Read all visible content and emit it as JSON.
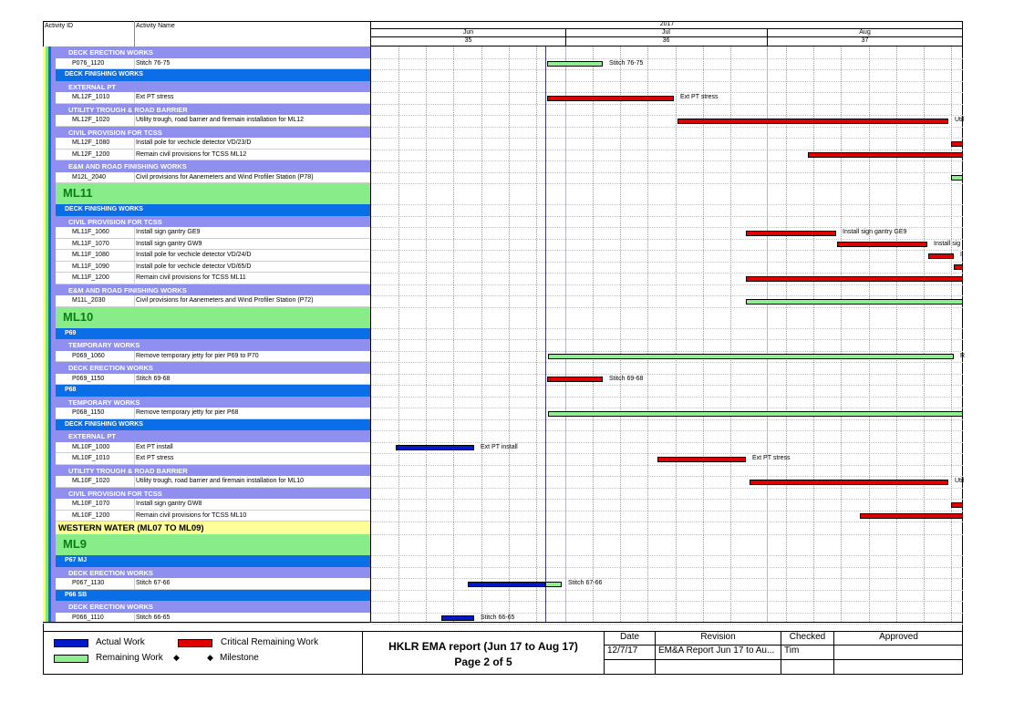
{
  "header": {
    "col_activity_id": "Activity ID",
    "col_activity_name": "Activity Name",
    "year": "2017",
    "months": [
      "Jun",
      "Jul",
      "Aug"
    ],
    "weeks": [
      "35",
      "36",
      "37"
    ]
  },
  "rows": [
    {
      "kind": "wbs3",
      "label": "DECK ERECTION WORKS"
    },
    {
      "kind": "act",
      "id": "P076_1120",
      "name": "Stitch 76-75",
      "bar": "green",
      "bar_label": "Stitch 76-75"
    },
    {
      "kind": "wbs2",
      "label": "DECK FINISHING WORKS"
    },
    {
      "kind": "wbs3",
      "label": "EXTERNAL PT"
    },
    {
      "kind": "act",
      "id": "ML12F_1010",
      "name": "Ext PT stress",
      "bar": "red",
      "bar_label": "Ext PT stress"
    },
    {
      "kind": "wbs3",
      "label": "UTILITY TROUGH & ROAD BARRIER"
    },
    {
      "kind": "act",
      "id": "ML12F_1020",
      "name": "Utility trough, road barrier and firemain installation for ML12",
      "bar": "red",
      "bar_label": "Util"
    },
    {
      "kind": "wbs3",
      "label": "CIVIL PROVISION FOR TCSS"
    },
    {
      "kind": "act",
      "id": "ML12F_1080",
      "name": "Install pole for vechicle detector VD/23/D",
      "bar": "red",
      "bar_label": ""
    },
    {
      "kind": "act",
      "id": "ML12F_1200",
      "name": "Remain civil provisions for TCSS ML12",
      "bar": "red",
      "bar_label": ""
    },
    {
      "kind": "wbs3",
      "label": "E&M AND ROAD FINISHING WORKS"
    },
    {
      "kind": "act",
      "id": "M12L_2040",
      "name": "Civil provisions for Aanemeters and Wind Profiler Station (P78)",
      "bar": "green",
      "bar_label": ""
    },
    {
      "kind": "ml",
      "label": "ML11"
    },
    {
      "kind": "wbs2",
      "label": "DECK FINISHING WORKS"
    },
    {
      "kind": "wbs3",
      "label": "CIVIL PROVISION FOR TCSS"
    },
    {
      "kind": "act",
      "id": "ML11F_1060",
      "name": "Install sign gantry GE9",
      "bar": "red",
      "bar_label": "Install sign gantry GE9"
    },
    {
      "kind": "act",
      "id": "ML11F_1070",
      "name": "Install sign gantry GW9",
      "bar": "red",
      "bar_label": "Install sig"
    },
    {
      "kind": "act",
      "id": "ML11F_1080",
      "name": "Install pole for vechicle detector VD/24/D",
      "bar": "red",
      "bar_label": "I"
    },
    {
      "kind": "act",
      "id": "ML11F_1090",
      "name": "Install pole for vechicle detector VD/65/D",
      "bar": "red",
      "bar_label": ""
    },
    {
      "kind": "act",
      "id": "ML11F_1200",
      "name": "Remain civil provisions for TCSS ML11",
      "bar": "red",
      "bar_label": ""
    },
    {
      "kind": "wbs3",
      "label": "E&M AND ROAD FINISHING WORKS"
    },
    {
      "kind": "act",
      "id": "M11L_2030",
      "name": "Civil provisions for Aanemeters and Wind Profiler Station (P72)",
      "bar": "green",
      "bar_label": ""
    },
    {
      "kind": "ml",
      "label": "ML10"
    },
    {
      "kind": "wbs2",
      "label": "P69"
    },
    {
      "kind": "wbs3",
      "label": "TEMPORARY WORKS"
    },
    {
      "kind": "act",
      "id": "P069_1060",
      "name": "Remove temporary jetty for pier P69 to P70",
      "bar": "green",
      "bar_label": "R"
    },
    {
      "kind": "wbs3",
      "label": "DECK ERECTION WORKS"
    },
    {
      "kind": "act",
      "id": "P069_1150",
      "name": "Stitch 69-68",
      "bar": "red",
      "bar_label": "Stitch 69-68"
    },
    {
      "kind": "wbs2",
      "label": "P68"
    },
    {
      "kind": "wbs3",
      "label": "TEMPORARY WORKS"
    },
    {
      "kind": "act",
      "id": "P068_1150",
      "name": "Remove temporary jetty for pier P68",
      "bar": "green",
      "bar_label": ""
    },
    {
      "kind": "wbs2",
      "label": "DECK FINISHING WORKS"
    },
    {
      "kind": "wbs3",
      "label": "EXTERNAL PT"
    },
    {
      "kind": "act",
      "id": "ML10F_1000",
      "name": "Ext PT install",
      "bar": "blue",
      "bar_label": "Ext PT install"
    },
    {
      "kind": "act",
      "id": "ML10F_1010",
      "name": "Ext PT stress",
      "bar": "red",
      "bar_label": "Ext PT stress"
    },
    {
      "kind": "wbs3",
      "label": "UTILITY TROUGH & ROAD BARRIER"
    },
    {
      "kind": "act",
      "id": "ML10F_1020",
      "name": "Utility trough, road barrier and firemain installation for ML10",
      "bar": "red",
      "bar_label": "Util"
    },
    {
      "kind": "wbs3",
      "label": "CIVIL PROVISION FOR TCSS"
    },
    {
      "kind": "act",
      "id": "ML10F_1070",
      "name": "Install sign gantry GW8",
      "bar": "red",
      "bar_label": ""
    },
    {
      "kind": "act",
      "id": "ML10F_1200",
      "name": "Remain civil provisions for TCSS ML10",
      "bar": "red",
      "bar_label": ""
    },
    {
      "kind": "ww",
      "label": "WESTERN WATER (ML07 TO ML09)"
    },
    {
      "kind": "ml",
      "label": "ML9"
    },
    {
      "kind": "wbs2",
      "label": "P67 MJ"
    },
    {
      "kind": "wbs3",
      "label": "DECK ERECTION WORKS"
    },
    {
      "kind": "act",
      "id": "P067_1130",
      "name": "Stitch 67-66",
      "bar": "bluegreen",
      "bar_label": "Stitch 67-66"
    },
    {
      "kind": "wbs2",
      "label": "P66 SB"
    },
    {
      "kind": "wbs3",
      "label": "DECK ERECTION WORKS"
    },
    {
      "kind": "act",
      "id": "P066_1110",
      "name": "Stitch 66-65",
      "bar": "blue",
      "bar_label": "Stitch 66-65"
    }
  ],
  "legend": {
    "actual": "Actual Work",
    "critical": "Critical Remaining Work",
    "remaining": "Remaining Work",
    "milestone": "Milestone"
  },
  "title_block": {
    "line1": "HKLR EMA report (Jun 17 to Aug 17)",
    "line2": "Page 2 of 5"
  },
  "revision_table": {
    "headers": [
      "Date",
      "Revision",
      "Checked",
      "Approved"
    ],
    "row": [
      "12/7/17",
      "EM&A Report Jun 17 to Au...",
      "Tim",
      ""
    ]
  },
  "colors": {
    "actual": "#0018c8",
    "critical": "#e10000",
    "remaining": "#90ee90",
    "wbs2": "#0a6fe6",
    "wbs3": "#8f8ff0",
    "ml": "#88ec88",
    "ww": "#ffff99"
  }
}
